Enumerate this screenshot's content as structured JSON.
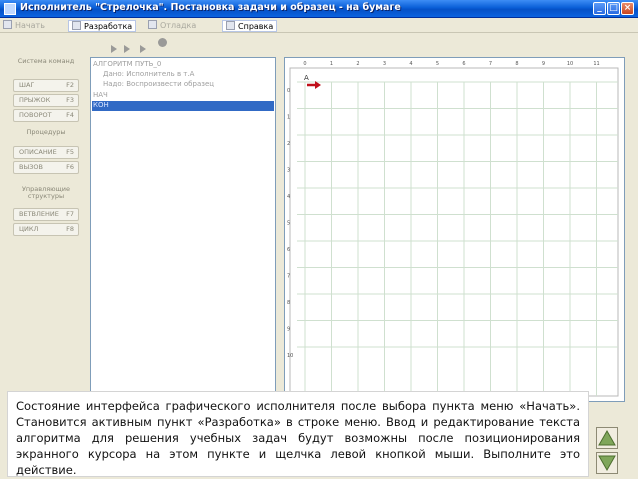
{
  "window": {
    "title": "Исполнитель \"Стрелочка\". Постановка задачи и образец - на бумаге",
    "controls": {
      "minimize": "_",
      "maximize": "□",
      "close": "×"
    }
  },
  "menu": {
    "items": [
      {
        "label": "Начать",
        "state": "disabled"
      },
      {
        "label": "Разработка",
        "state": "active"
      },
      {
        "label": "Отладка",
        "state": "disabled"
      },
      {
        "label": "Справка",
        "state": "active"
      }
    ]
  },
  "toolbar": {
    "icons": [
      "play-icon",
      "fast-forward-icon",
      "step-icon",
      "stop-icon"
    ]
  },
  "left_panel": {
    "group_system": "Система команд",
    "cmd_step": {
      "label": "ШАГ",
      "shortcut": "F2"
    },
    "cmd_jump": {
      "label": "ПРЫЖОК",
      "shortcut": "F3"
    },
    "cmd_turn": {
      "label": "ПОВОРОТ",
      "shortcut": "F4"
    },
    "group_procedures": "Процедуры",
    "cmd_desc": {
      "label": "ОПИСАНИЕ",
      "shortcut": "F5"
    },
    "cmd_call": {
      "label": "ВЫЗОВ",
      "shortcut": "F6"
    },
    "group_control": "Управляющие структуры",
    "cmd_branch": {
      "label": "ВЕТВЛЕНИЕ",
      "shortcut": "F7"
    },
    "cmd_loop": {
      "label": "ЦИКЛ",
      "shortcut": "F8"
    }
  },
  "editor": {
    "lines": [
      "АЛГОРИТМ ПУТЬ_0",
      "Дано: Исполнитель в т.А",
      "Надо: Воспроизвести образец",
      "НАЧ",
      "КОН"
    ],
    "selected_line_index": 4
  },
  "grid": {
    "columns": [
      "0",
      "1",
      "2",
      "3",
      "4",
      "5",
      "6",
      "7",
      "8",
      "9",
      "10",
      "11"
    ],
    "rows": [
      "0",
      "1",
      "2",
      "3",
      "4",
      "5",
      "6",
      "7",
      "8",
      "9",
      "10"
    ],
    "point_label": "A",
    "arrow_color": "#c0101a",
    "grid_color": "#cfe0cf"
  },
  "caption": {
    "text": "Состояние интерфейса графического исполнителя после выбора пункта меню «Начать». Становится активным пункт «Разработка» в строке меню. Ввод и редактирование текста алгоритма для решения учебных задач будут возможны после позиционирования экранного курсора на этом пункте и щелчка левой кнопкой мыши. Выполните это действие."
  },
  "colors": {
    "titlebar": "#0a5fd8",
    "selection": "#316ac5",
    "arrow_buttons": "#7fa65a"
  }
}
